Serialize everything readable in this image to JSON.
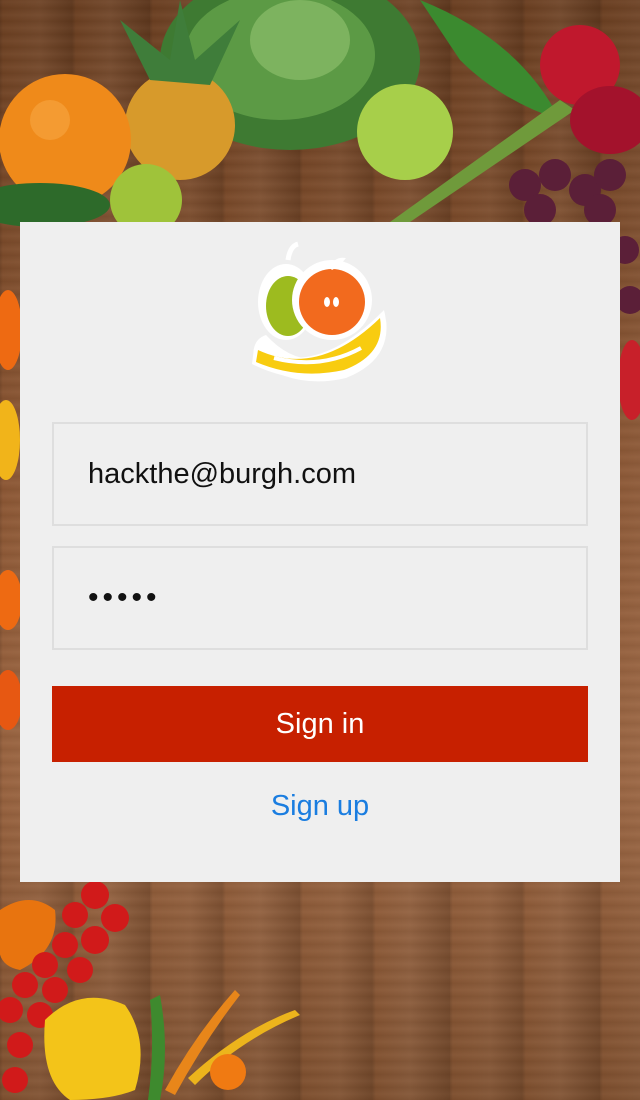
{
  "login_form": {
    "email_value": "hackthe@burgh.com",
    "password_value": "•••••",
    "signin_label": "Sign in",
    "signup_label": "Sign up"
  },
  "colors": {
    "primary_button": "#c72000",
    "link": "#1a7de0",
    "card_bg": "#efefef"
  },
  "icons": [
    "fruit-basket-logo-icon"
  ]
}
